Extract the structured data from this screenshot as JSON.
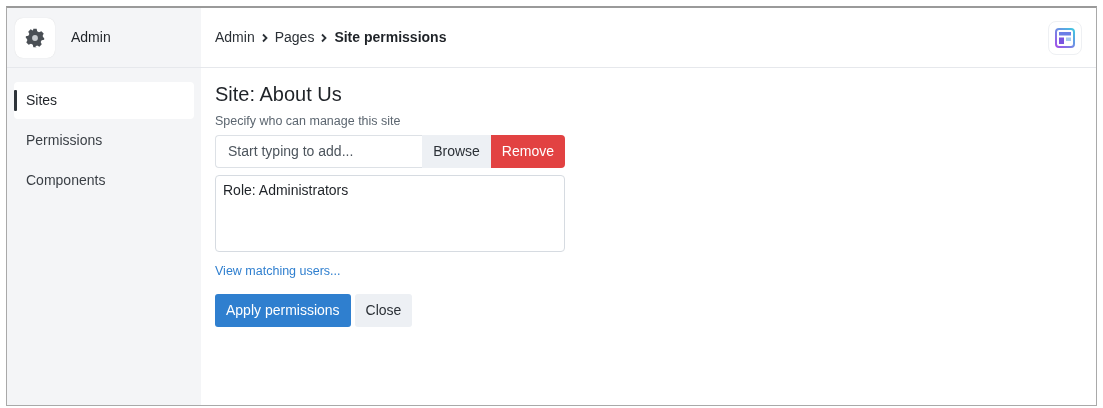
{
  "app": {
    "title": "Admin"
  },
  "sidebar": {
    "items": [
      {
        "label": "Sites",
        "selected": true
      },
      {
        "label": "Permissions",
        "selected": false
      },
      {
        "label": "Components",
        "selected": false
      }
    ]
  },
  "breadcrumb": [
    {
      "label": "Admin",
      "current": false
    },
    {
      "label": "Pages",
      "current": false
    },
    {
      "label": "Site permissions",
      "current": true
    }
  ],
  "heading": "Site: About Us",
  "field_label": "Specify who can manage this site",
  "search": {
    "placeholder": "Start typing to add..."
  },
  "field_buttons": [
    {
      "label": "Browse",
      "kind": "secondary"
    },
    {
      "label": "Remove",
      "kind": "danger"
    }
  ],
  "assigned": [
    "Role: Administrators"
  ],
  "link": "View matching users...",
  "actions": [
    {
      "label": "Apply permissions",
      "kind": "primary"
    },
    {
      "label": "Close",
      "kind": "secondary"
    }
  ]
}
